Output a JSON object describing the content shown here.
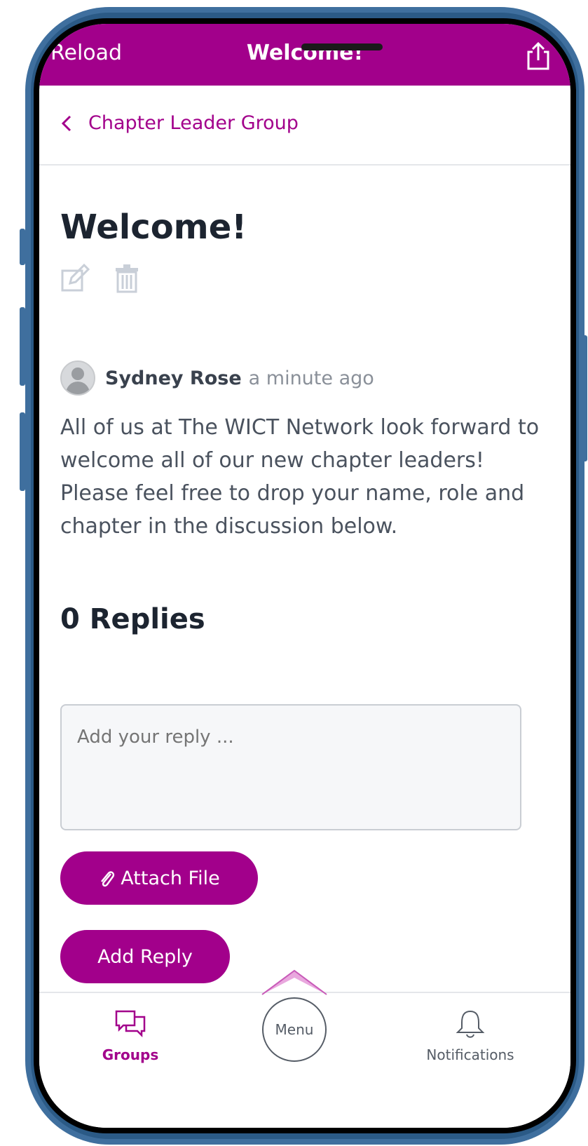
{
  "appbar": {
    "left_action": "Reload",
    "title": "Welcome!",
    "share_icon": "share-icon"
  },
  "breadcrumb": {
    "label": "Chapter Leader Group",
    "icon": "chevron-left-icon"
  },
  "post": {
    "title": "Welcome!",
    "author": "Sydney Rose",
    "time": "a minute ago",
    "body": "All of us at The WICT Network look forward to welcome all of our new chapter leaders! Please feel free to drop your name, role and chapter in the discussion below."
  },
  "replies": {
    "heading": "0 Replies",
    "placeholder": "Add your reply ...",
    "attach_label": "Attach File",
    "add_reply_label": "Add Reply"
  },
  "tabbar": {
    "groups_label": "Groups",
    "menu_label": "Menu",
    "notifications_label": "Notifications"
  },
  "colors": {
    "brand": "#a2008b",
    "device": "#3f6f9e"
  }
}
